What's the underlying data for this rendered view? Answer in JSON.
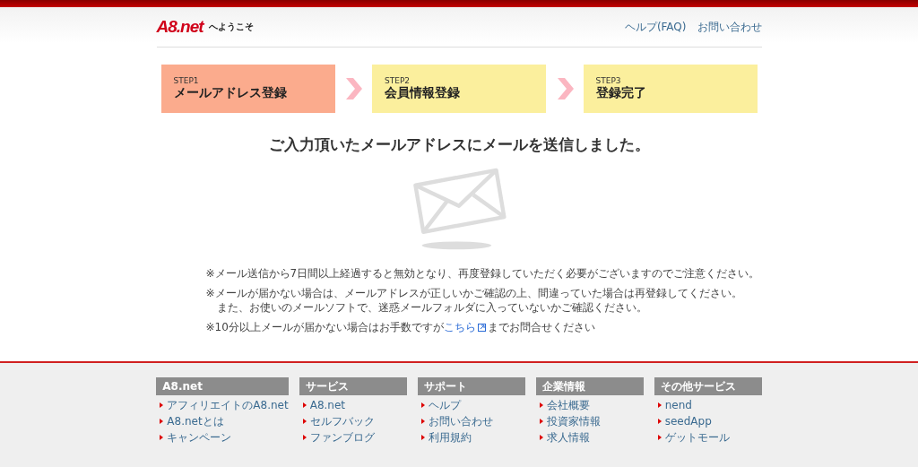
{
  "header": {
    "logo": "A8.net",
    "welcome": "へようこそ",
    "links": [
      "ヘルプ(FAQ)",
      "お問い合わせ"
    ]
  },
  "steps": [
    {
      "label": "STEP1",
      "title": "メールアドレス登録",
      "selected": true
    },
    {
      "label": "STEP2",
      "title": "会員情報登録",
      "selected": false
    },
    {
      "label": "STEP3",
      "title": "登録完了",
      "selected": false
    }
  ],
  "heading": "ご入力頂いたメールアドレスにメールを送信しました。",
  "notes": [
    {
      "lines": [
        "※メール送信から7日間以上経過すると無効となり、再度登録していただく必要がございますのでご注意ください。"
      ]
    },
    {
      "lines": [
        "※メールが届かない場合は、メールアドレスが正しいかご確認の上、間違っていた場合は再登録してください。",
        "また、お使いのメールソフトで、迷惑メールフォルダに入っていないかご確認ください。"
      ]
    },
    {
      "lines": [
        "※10分以上メールが届かない場合はお手数ですが"
      ],
      "link": "こちら",
      "after": "までお問合せください"
    }
  ],
  "footer": [
    {
      "title": "A8.net",
      "items": [
        "アフィリエイトのA8.net",
        "A8.netとは",
        "キャンペーン"
      ]
    },
    {
      "title": "サービス",
      "items": [
        "A8.net",
        "セルフバック",
        "ファンブログ"
      ]
    },
    {
      "title": "サポート",
      "items": [
        "ヘルプ",
        "お問い合わせ",
        "利用規約"
      ]
    },
    {
      "title": "企業情報",
      "items": [
        "会社概要",
        "投資家情報",
        "求人情報"
      ]
    },
    {
      "title": "その他サービス",
      "items": [
        "nend",
        "seedApp",
        "ゲットモール"
      ]
    }
  ]
}
